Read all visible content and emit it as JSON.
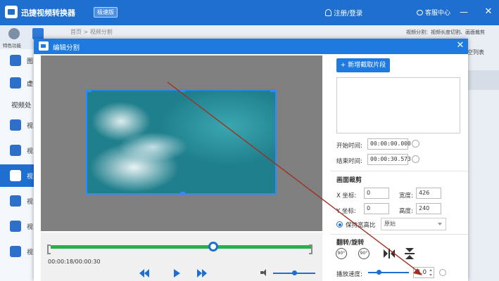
{
  "app": {
    "title": "迅捷视频转换器",
    "badge": "极速版",
    "login": "注册/登录",
    "service": "客服中心",
    "minimize": "—",
    "close": "✕"
  },
  "sidebar": {
    "top_label": "特色功能",
    "section_label": "视频处",
    "items": [
      {
        "label": "图"
      },
      {
        "label": "虚"
      },
      {
        "label": "视"
      },
      {
        "label": "视"
      },
      {
        "label": "视"
      },
      {
        "label": "视"
      },
      {
        "label": "视"
      },
      {
        "label": "视"
      }
    ]
  },
  "breadcrumb": {
    "home": "首页",
    "sep": ">",
    "current": "视频分割"
  },
  "background": {
    "right_hint": "视频分割：视频长度切割、画面裁剪",
    "clear_list": "空列表"
  },
  "dialog": {
    "title": "编辑分割",
    "close": "✕",
    "timeline": {
      "time_display": "00:00:18/00:00:30",
      "progress": 0.62
    },
    "volume_level": 0.5,
    "panel": {
      "add_segment": "+ 新增截取片段",
      "start_label": "开始时间:",
      "start_value": "00:00:00.000",
      "end_label": "结束时间:",
      "end_value": "00:00:30.573",
      "crop_title": "画面裁剪",
      "x_label": "X 坐标:",
      "x_value": "0",
      "width_label": "宽度:",
      "width_value": "426",
      "y_label": "Y 坐标:",
      "y_value": "0",
      "height_label": "高度:",
      "height_value": "240",
      "keep_ratio": "保持宽高比",
      "ratio_option": "原始",
      "rotate_title": "翻转/旋转",
      "rotate_left": "90°",
      "rotate_right": "90°",
      "speed_label": "播放速度:",
      "speed_value": "1.0",
      "speed_level": 0.25
    }
  },
  "colors": {
    "brand": "#1f6fd0",
    "timeline_green": "#27b14b",
    "crop_border": "#2b8cff",
    "annotation_arrow": "#a0301f"
  }
}
